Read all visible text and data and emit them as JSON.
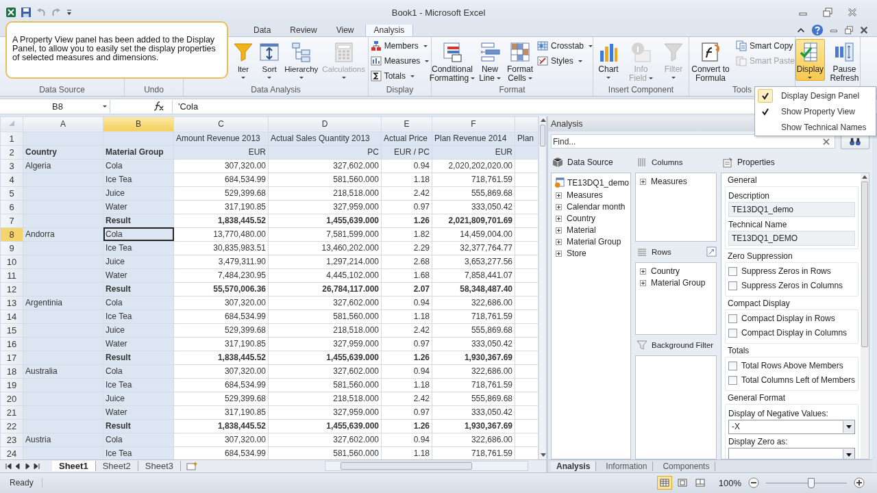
{
  "window": {
    "title": "Book1  -  Microsoft Excel"
  },
  "callout": {
    "text": "A Property View panel has been added to the Display Panel, to allow you to easily set the display properties of selected measures and dimensions."
  },
  "tabs": [
    {
      "label": "Data",
      "selected": false
    },
    {
      "label": "Review",
      "selected": false
    },
    {
      "label": "View",
      "selected": false
    },
    {
      "label": "Analysis",
      "selected": true
    }
  ],
  "ribbon": {
    "groups": [
      {
        "label": "Data Source"
      },
      {
        "label": "Undo"
      },
      {
        "label": "Data Analysis",
        "buttons": [
          {
            "kind": "large",
            "lines": [
              "lter"
            ],
            "dropdown": true,
            "disabled": false,
            "active": false
          },
          {
            "kind": "large",
            "lines": [
              "Sort"
            ],
            "dropdown": true,
            "disabled": false,
            "active": false
          },
          {
            "kind": "large",
            "lines": [
              "Hierarchy"
            ],
            "dropdown": true,
            "disabled": false,
            "active": false
          },
          {
            "kind": "large",
            "lines": [
              "Calculations"
            ],
            "dropdown": true,
            "disabled": true,
            "active": false
          }
        ]
      },
      {
        "label": "Display",
        "buttons": [
          {
            "kind": "stack",
            "items": [
              {
                "label": "Members",
                "dropdown": true,
                "disabled": false
              },
              {
                "label": "Measures",
                "dropdown": true,
                "disabled": false
              },
              {
                "label": "Totals",
                "dropdown": true,
                "disabled": false
              }
            ]
          }
        ]
      },
      {
        "label": "Format",
        "buttons": [
          {
            "kind": "large",
            "lines": [
              "Conditional",
              "Formatting"
            ],
            "dropdown": true,
            "disabled": false,
            "active": false
          },
          {
            "kind": "large",
            "lines": [
              "New",
              "Line"
            ],
            "dropdown": true,
            "disabled": false,
            "active": false
          },
          {
            "kind": "large",
            "lines": [
              "Format",
              "Cells"
            ],
            "dropdown": true,
            "disabled": false,
            "active": false
          },
          {
            "kind": "stack",
            "items": [
              {
                "label": "Crosstab",
                "dropdown": true,
                "disabled": false
              },
              {
                "label": "Styles",
                "dropdown": true,
                "disabled": false
              }
            ]
          }
        ]
      },
      {
        "label": "Insert Component",
        "buttons": [
          {
            "kind": "large",
            "lines": [
              "Chart"
            ],
            "dropdown": true,
            "disabled": false,
            "active": false
          },
          {
            "kind": "large",
            "lines": [
              "Info",
              "Field"
            ],
            "dropdown": true,
            "disabled": true,
            "active": false
          },
          {
            "kind": "large",
            "lines": [
              "Filter"
            ],
            "dropdown": true,
            "disabled": true,
            "active": false
          }
        ]
      },
      {
        "label": "Tools",
        "buttons": [
          {
            "kind": "large",
            "lines": [
              "Convert to",
              "Formula"
            ],
            "dropdown": false,
            "disabled": false,
            "active": false
          },
          {
            "kind": "stack",
            "items": [
              {
                "label": "Smart Copy",
                "dropdown": false,
                "disabled": false
              },
              {
                "label": "Smart Paste",
                "dropdown": false,
                "disabled": true
              }
            ]
          }
        ]
      },
      {
        "buttons": [
          {
            "kind": "large",
            "lines": [
              "Display"
            ],
            "dropdown": true,
            "disabled": false,
            "active": true
          },
          {
            "kind": "large",
            "lines": [
              "Pause",
              "Refresh"
            ],
            "dropdown": false,
            "disabled": false,
            "active": false
          }
        ]
      }
    ]
  },
  "display_menu": {
    "items": [
      {
        "label": "Display Design Panel",
        "checked": true,
        "selected": true
      },
      {
        "label": "Show Property View",
        "checked": true,
        "selected": false
      },
      {
        "label": "Show Technical Names",
        "checked": false,
        "selected": false
      }
    ]
  },
  "formula_bar": {
    "name_box": "B8",
    "formula": "'Cola"
  },
  "sheet": {
    "columns": [
      {
        "label": "A",
        "selected": false
      },
      {
        "label": "B",
        "selected": true
      },
      {
        "label": "C",
        "selected": false
      },
      {
        "label": "D",
        "selected": false
      },
      {
        "label": "E",
        "selected": false
      },
      {
        "label": "F",
        "selected": false
      }
    ],
    "rows": [
      {
        "num": "1",
        "kind": "header",
        "selected": false,
        "c": "Amount Revenue 2013",
        "d": "Actual Sales Quantity 2013",
        "e": "Actual Price",
        "f": "Plan Revenue 2014",
        "g": "Plan"
      },
      {
        "num": "2",
        "kind": "units",
        "selected": false,
        "a": "Country",
        "b": "Material Group",
        "c": "EUR",
        "d": "PC",
        "e": "EUR / PC",
        "f": "EUR"
      },
      {
        "num": "3",
        "kind": "data",
        "selected": false,
        "a": "Algeria",
        "b": "Cola",
        "c": "307,320.00",
        "d": "327,602.000",
        "e": "0.94",
        "f": "2,020,202,020.00"
      },
      {
        "num": "4",
        "kind": "data",
        "selected": false,
        "b": "Ice Tea",
        "c": "684,534.99",
        "d": "581,560.000",
        "e": "1.18",
        "f": "718,761.59"
      },
      {
        "num": "5",
        "kind": "data",
        "selected": false,
        "b": "Juice",
        "c": "529,399.68",
        "d": "218,518.000",
        "e": "2.42",
        "f": "555,869.68"
      },
      {
        "num": "6",
        "kind": "data",
        "selected": false,
        "b": "Water",
        "c": "317,190.85",
        "d": "327,959.000",
        "e": "0.97",
        "f": "333,050.42"
      },
      {
        "num": "7",
        "kind": "result",
        "selected": false,
        "b": "Result",
        "c": "1,838,445.52",
        "d": "1,455,639.000",
        "e": "1.26",
        "f": "2,021,809,701.69"
      },
      {
        "num": "8",
        "kind": "data",
        "selected": true,
        "a": "Andorra",
        "b": "Cola",
        "c": "13,770,480.00",
        "d": "7,581,599.000",
        "e": "1.82",
        "f": "14,459,004.00"
      },
      {
        "num": "9",
        "kind": "data",
        "selected": false,
        "b": "Ice Tea",
        "c": "30,835,983.51",
        "d": "13,460,202.000",
        "e": "2.29",
        "f": "32,377,764.77"
      },
      {
        "num": "10",
        "kind": "data",
        "selected": false,
        "b": "Juice",
        "c": "3,479,311.90",
        "d": "1,297,214.000",
        "e": "2.68",
        "f": "3,653,277.56"
      },
      {
        "num": "11",
        "kind": "data",
        "selected": false,
        "b": "Water",
        "c": "7,484,230.95",
        "d": "4,445,102.000",
        "e": "1.68",
        "f": "7,858,441.07"
      },
      {
        "num": "12",
        "kind": "result",
        "selected": false,
        "b": "Result",
        "c": "55,570,006.36",
        "d": "26,784,117.000",
        "e": "2.07",
        "f": "58,348,487.40"
      },
      {
        "num": "13",
        "kind": "data",
        "selected": false,
        "a": "Argentinia",
        "b": "Cola",
        "c": "307,320.00",
        "d": "327,602.000",
        "e": "0.94",
        "f": "322,686.00"
      },
      {
        "num": "14",
        "kind": "data",
        "selected": false,
        "b": "Ice Tea",
        "c": "684,534.99",
        "d": "581,560.000",
        "e": "1.18",
        "f": "718,761.59"
      },
      {
        "num": "15",
        "kind": "data",
        "selected": false,
        "b": "Juice",
        "c": "529,399.68",
        "d": "218,518.000",
        "e": "2.42",
        "f": "555,869.68"
      },
      {
        "num": "16",
        "kind": "data",
        "selected": false,
        "b": "Water",
        "c": "317,190.85",
        "d": "327,959.000",
        "e": "0.97",
        "f": "333,050.42"
      },
      {
        "num": "17",
        "kind": "result",
        "selected": false,
        "b": "Result",
        "c": "1,838,445.52",
        "d": "1,455,639.000",
        "e": "1.26",
        "f": "1,930,367.69"
      },
      {
        "num": "18",
        "kind": "data",
        "selected": false,
        "a": "Australia",
        "b": "Cola",
        "c": "307,320.00",
        "d": "327,602.000",
        "e": "0.94",
        "f": "322,686.00"
      },
      {
        "num": "19",
        "kind": "data",
        "selected": false,
        "b": "Ice Tea",
        "c": "684,534.99",
        "d": "581,560.000",
        "e": "1.18",
        "f": "718,761.59"
      },
      {
        "num": "20",
        "kind": "data",
        "selected": false,
        "b": "Juice",
        "c": "529,399.68",
        "d": "218,518.000",
        "e": "2.42",
        "f": "555,869.68"
      },
      {
        "num": "21",
        "kind": "data",
        "selected": false,
        "b": "Water",
        "c": "317,190.85",
        "d": "327,959.000",
        "e": "0.97",
        "f": "333,050.42"
      },
      {
        "num": "22",
        "kind": "result",
        "selected": false,
        "b": "Result",
        "c": "1,838,445.52",
        "d": "1,455,639.000",
        "e": "1.26",
        "f": "1,930,367.69"
      },
      {
        "num": "23",
        "kind": "data",
        "selected": false,
        "a": "Austria",
        "b": "Cola",
        "c": "307,320.00",
        "d": "327,602.000",
        "e": "0.94",
        "f": "322,686.00"
      },
      {
        "num": "24",
        "kind": "data",
        "selected": false,
        "b": "Ice Tea",
        "c": "684,534.99",
        "d": "581,560.000",
        "e": "1.18",
        "f": "718,761.59"
      }
    ],
    "tabs": [
      {
        "label": "Sheet1",
        "selected": true
      },
      {
        "label": "Sheet2",
        "selected": false
      },
      {
        "label": "Sheet3",
        "selected": false
      }
    ]
  },
  "panel": {
    "title": "Analysis",
    "find": {
      "placeholder": "Find..."
    },
    "data_source": {
      "title": "Data Source",
      "root": "TE13DQ1_demo",
      "items": [
        {
          "label": "Measures",
          "expanded": false
        },
        {
          "label": "Calendar month",
          "expanded": false
        },
        {
          "label": "Country",
          "expanded": false
        },
        {
          "label": "Material",
          "expanded": false
        },
        {
          "label": "Material Group",
          "expanded": false
        },
        {
          "label": "Store",
          "expanded": false
        }
      ]
    },
    "columns": {
      "title": "Columns",
      "items": [
        {
          "label": "Measures",
          "expanded": false
        }
      ]
    },
    "rows": {
      "title": "Rows",
      "items": [
        {
          "label": "Country",
          "expanded": false
        },
        {
          "label": "Material Group",
          "expanded": false
        }
      ]
    },
    "background_filter": {
      "title": "Background Filter"
    },
    "properties": {
      "title": "Properties",
      "sections": [
        {
          "title": "General",
          "items": [
            {
              "kind": "field",
              "label": "Description",
              "value": "TE13DQ1_demo"
            },
            {
              "kind": "field",
              "label": "Technical Name",
              "value": "TE13DQ1_DEMO"
            }
          ]
        },
        {
          "title": "Zero Suppression",
          "items": [
            {
              "kind": "checkbox",
              "label": "Suppress Zeros in Rows",
              "checked": false
            },
            {
              "kind": "checkbox",
              "label": "Suppress Zeros in Columns",
              "checked": false
            }
          ]
        },
        {
          "title": "Compact Display",
          "items": [
            {
              "kind": "checkbox",
              "label": "Compact Display in Rows",
              "checked": false
            },
            {
              "kind": "checkbox",
              "label": "Compact Display in Columns",
              "checked": false
            }
          ]
        },
        {
          "title": "Totals",
          "items": [
            {
              "kind": "checkbox",
              "label": "Total Rows Above Members",
              "checked": false
            },
            {
              "kind": "checkbox",
              "label": "Total Columns Left of Members",
              "checked": false
            }
          ]
        },
        {
          "title": "General Format",
          "items": [
            {
              "kind": "select",
              "label": "Display of Negative Values:",
              "value": "-X"
            },
            {
              "kind": "select",
              "label": "Display Zero as:"
            }
          ]
        }
      ]
    },
    "tabs": [
      {
        "label": "Analysis",
        "selected": true
      },
      {
        "label": "Information",
        "selected": false
      },
      {
        "label": "Components",
        "selected": false
      }
    ]
  },
  "status_bar": {
    "text": "Ready",
    "views": [
      {
        "selected": true
      },
      {
        "selected": false
      },
      {
        "selected": false
      }
    ],
    "zoom": "100%",
    "zoom_slider": {
      "level": 0.55
    }
  }
}
